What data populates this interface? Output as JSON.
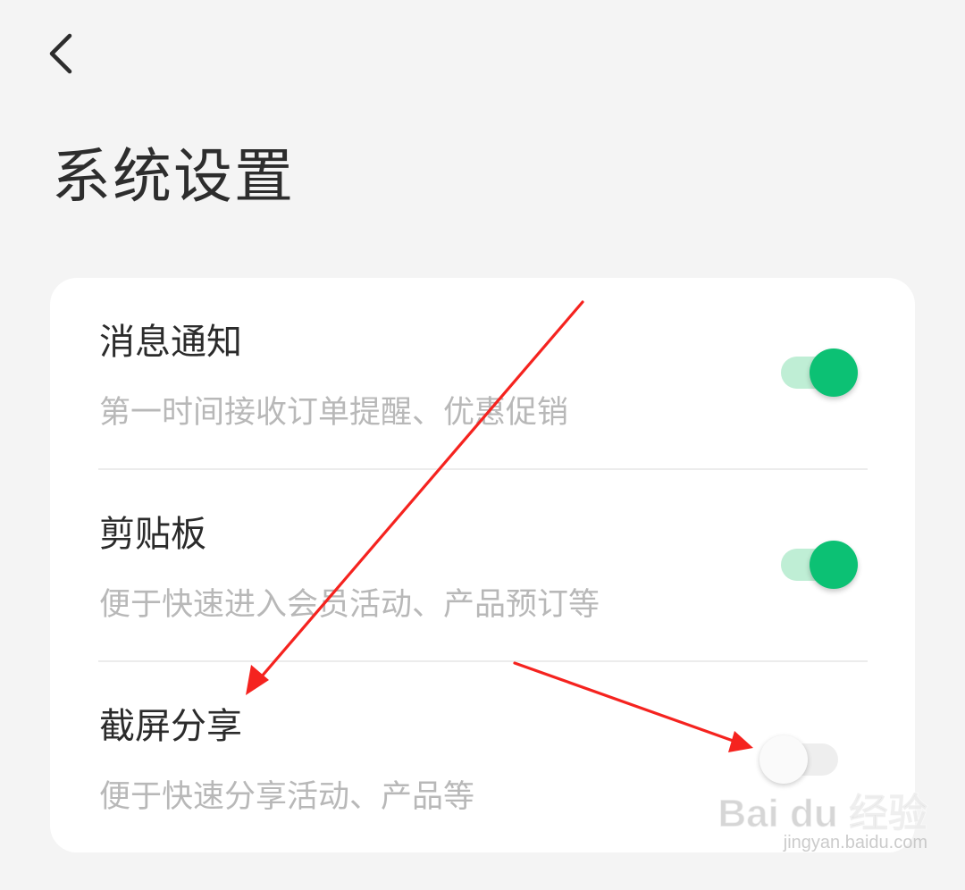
{
  "header": {
    "back_icon": "chevron-left-icon",
    "title": "系统设置"
  },
  "settings": [
    {
      "title": "消息通知",
      "description": "第一时间接收订单提醒、优惠促销",
      "enabled": true
    },
    {
      "title": "剪贴板",
      "description": "便于快速进入会员活动、产品预订等",
      "enabled": true
    },
    {
      "title": "截屏分享",
      "description": "便于快速分享活动、产品等",
      "enabled": false
    }
  ],
  "colors": {
    "background": "#f4f4f4",
    "card": "#ffffff",
    "toggle_on": "#0cc174",
    "toggle_on_track": "#bfeed5",
    "toggle_off_track": "#eeeeee",
    "annotation_arrow": "#f5231f"
  },
  "watermark": {
    "logo": "Bai du 经验",
    "url": "jingyan.baidu.com"
  }
}
